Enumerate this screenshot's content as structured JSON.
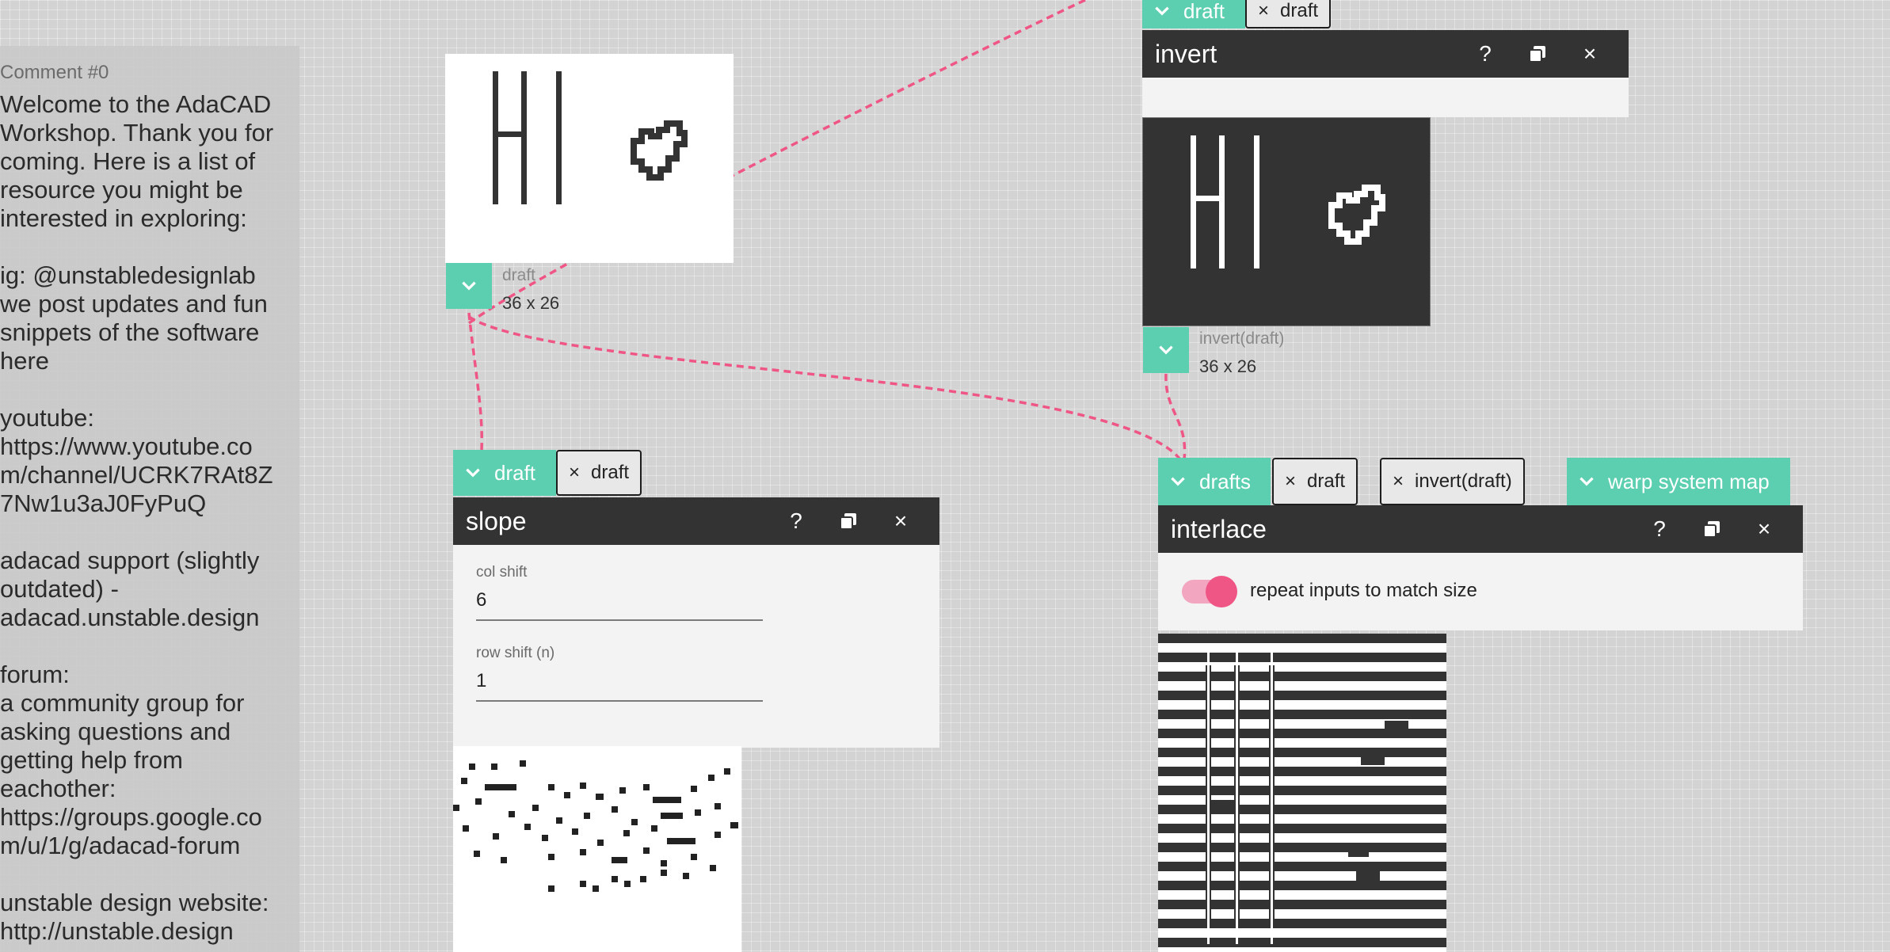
{
  "comment": {
    "title": "Comment #0",
    "body": "Welcome to the AdaCAD\nWorkshop. Thank you for\ncoming. Here is a list of\nresource you might be\ninterested in exploring:\n\nig: @unstabledesignlab\nwe post updates and fun\nsnippets of the software\nhere\n\nyoutube:\nhttps://www.youtube.co\nm/channel/UCRK7RAt8Z\n7Nw1u3aJ0FyPuQ\n\nadacad support (slightly\noutdated) -\nadacad.unstable.design\n\nforum:\na community group for\nasking questions and\ngetting help from\neachother:\nhttps://groups.google.co\nm/u/1/g/adacad-forum\n\nunstable design website:\nhttp://unstable.design"
  },
  "draft_node": {
    "name": "draft",
    "size": "36 x 26"
  },
  "invert_op": {
    "input_label": "draft",
    "chip": "draft",
    "title": "invert",
    "output_name": "invert(draft)",
    "output_size": "36 x 26"
  },
  "slope_op": {
    "input_label": "draft",
    "chip": "draft",
    "title": "slope",
    "params": [
      {
        "label": "col shift",
        "value": "6"
      },
      {
        "label": "row shift (n)",
        "value": "1"
      }
    ]
  },
  "interlace_op": {
    "input_label": "drafts",
    "chips": [
      "draft",
      "invert(draft)"
    ],
    "warp_label": "warp system map",
    "title": "interlace",
    "toggle_label": "repeat inputs to match size",
    "toggle_on": true
  },
  "icons": {
    "help": "?",
    "duplicate": "duplicate-icon",
    "close": "×",
    "remove": "×"
  },
  "colors": {
    "accent": "#5ccfb0",
    "connection": "#ef5585",
    "titlebar": "#333333"
  }
}
